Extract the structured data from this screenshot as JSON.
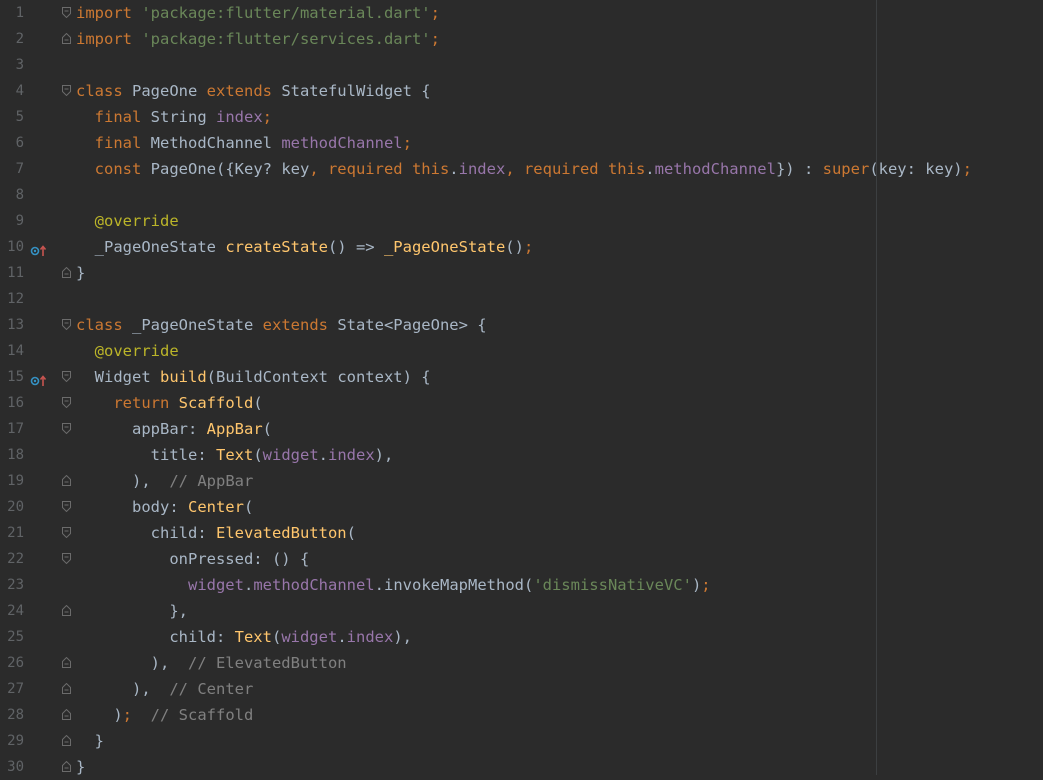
{
  "editor": {
    "language": "dart",
    "lines": [
      {
        "n": "1",
        "fold": "start",
        "mark": "",
        "tokens": [
          [
            "kw",
            "import "
          ],
          [
            "str",
            "'package:flutter/material.dart'"
          ],
          [
            "kw",
            ";"
          ]
        ]
      },
      {
        "n": "2",
        "fold": "end",
        "mark": "",
        "tokens": [
          [
            "kw",
            "import "
          ],
          [
            "str",
            "'package:flutter/services.dart'"
          ],
          [
            "kw",
            ";"
          ]
        ]
      },
      {
        "n": "3",
        "fold": "",
        "mark": "",
        "tokens": []
      },
      {
        "n": "4",
        "fold": "start",
        "mark": "",
        "tokens": [
          [
            "kw",
            "class "
          ],
          [
            "pl",
            "PageOne "
          ],
          [
            "kw",
            "extends "
          ],
          [
            "pl",
            "StatefulWidget {"
          ]
        ]
      },
      {
        "n": "5",
        "fold": "",
        "mark": "",
        "tokens": [
          [
            "pl",
            "  "
          ],
          [
            "kw",
            "final "
          ],
          [
            "pl",
            "String "
          ],
          [
            "fld",
            "index"
          ],
          [
            "kw",
            ";"
          ]
        ]
      },
      {
        "n": "6",
        "fold": "",
        "mark": "",
        "tokens": [
          [
            "pl",
            "  "
          ],
          [
            "kw",
            "final "
          ],
          [
            "pl",
            "MethodChannel "
          ],
          [
            "fld",
            "methodChannel"
          ],
          [
            "kw",
            ";"
          ]
        ]
      },
      {
        "n": "7",
        "fold": "",
        "mark": "",
        "tokens": [
          [
            "pl",
            "  "
          ],
          [
            "kw",
            "const "
          ],
          [
            "pl",
            "PageOne({Key? key"
          ],
          [
            "kw",
            ", required this"
          ],
          [
            "pl",
            "."
          ],
          [
            "fld",
            "index"
          ],
          [
            "kw",
            ", required this"
          ],
          [
            "pl",
            "."
          ],
          [
            "fld",
            "methodChannel"
          ],
          [
            "pl",
            "}) : "
          ],
          [
            "kw",
            "super"
          ],
          [
            "pl",
            "(key: key)"
          ],
          [
            "kw",
            ";"
          ]
        ]
      },
      {
        "n": "8",
        "fold": "",
        "mark": "",
        "tokens": []
      },
      {
        "n": "9",
        "fold": "",
        "mark": "",
        "tokens": [
          [
            "pl",
            "  "
          ],
          [
            "ann",
            "@override"
          ]
        ]
      },
      {
        "n": "10",
        "fold": "",
        "mark": "override",
        "tokens": [
          [
            "pl",
            "  _PageOneState "
          ],
          [
            "fn",
            "createState"
          ],
          [
            "pl",
            "() => "
          ],
          [
            "fn",
            "_PageOneState"
          ],
          [
            "pl",
            "()"
          ],
          [
            "kw",
            ";"
          ]
        ]
      },
      {
        "n": "11",
        "fold": "end",
        "mark": "",
        "tokens": [
          [
            "pl",
            "}"
          ]
        ]
      },
      {
        "n": "12",
        "fold": "",
        "mark": "",
        "tokens": []
      },
      {
        "n": "13",
        "fold": "start",
        "mark": "",
        "tokens": [
          [
            "kw",
            "class "
          ],
          [
            "pl",
            "_PageOneState "
          ],
          [
            "kw",
            "extends "
          ],
          [
            "pl",
            "State<PageOne> {"
          ]
        ]
      },
      {
        "n": "14",
        "fold": "",
        "mark": "",
        "tokens": [
          [
            "pl",
            "  "
          ],
          [
            "ann",
            "@override"
          ]
        ]
      },
      {
        "n": "15",
        "fold": "start",
        "mark": "override",
        "tokens": [
          [
            "pl",
            "  Widget "
          ],
          [
            "fn",
            "build"
          ],
          [
            "pl",
            "(BuildContext context) {"
          ]
        ]
      },
      {
        "n": "16",
        "fold": "start",
        "mark": "",
        "tokens": [
          [
            "pl",
            "    "
          ],
          [
            "kw",
            "return "
          ],
          [
            "fn",
            "Scaffold"
          ],
          [
            "pl",
            "("
          ]
        ]
      },
      {
        "n": "17",
        "fold": "start",
        "mark": "",
        "tokens": [
          [
            "pl",
            "      appBar: "
          ],
          [
            "fn",
            "AppBar"
          ],
          [
            "pl",
            "("
          ]
        ]
      },
      {
        "n": "18",
        "fold": "",
        "mark": "",
        "tokens": [
          [
            "pl",
            "        title: "
          ],
          [
            "fn",
            "Text"
          ],
          [
            "pl",
            "("
          ],
          [
            "fld",
            "widget"
          ],
          [
            "pl",
            "."
          ],
          [
            "fld",
            "index"
          ],
          [
            "pl",
            "),"
          ]
        ]
      },
      {
        "n": "19",
        "fold": "end",
        "mark": "",
        "tokens": [
          [
            "pl",
            "      ),  "
          ],
          [
            "cm",
            "// AppBar"
          ]
        ]
      },
      {
        "n": "20",
        "fold": "start",
        "mark": "",
        "tokens": [
          [
            "pl",
            "      body: "
          ],
          [
            "fn",
            "Center"
          ],
          [
            "pl",
            "("
          ]
        ]
      },
      {
        "n": "21",
        "fold": "start",
        "mark": "",
        "tokens": [
          [
            "pl",
            "        child: "
          ],
          [
            "fn",
            "ElevatedButton"
          ],
          [
            "pl",
            "("
          ]
        ]
      },
      {
        "n": "22",
        "fold": "start",
        "mark": "",
        "tokens": [
          [
            "pl",
            "          onPressed: () {"
          ]
        ]
      },
      {
        "n": "23",
        "fold": "",
        "mark": "",
        "tokens": [
          [
            "pl",
            "            "
          ],
          [
            "fld",
            "widget"
          ],
          [
            "pl",
            "."
          ],
          [
            "fld",
            "methodChannel"
          ],
          [
            "pl",
            "."
          ],
          [
            "pl",
            "invokeMapMethod("
          ],
          [
            "str",
            "'dismissNativeVC'"
          ],
          [
            "pl",
            ")"
          ],
          [
            "kw",
            ";"
          ]
        ]
      },
      {
        "n": "24",
        "fold": "end",
        "mark": "",
        "tokens": [
          [
            "pl",
            "          },"
          ]
        ]
      },
      {
        "n": "25",
        "fold": "",
        "mark": "",
        "tokens": [
          [
            "pl",
            "          child: "
          ],
          [
            "fn",
            "Text"
          ],
          [
            "pl",
            "("
          ],
          [
            "fld",
            "widget"
          ],
          [
            "pl",
            "."
          ],
          [
            "fld",
            "index"
          ],
          [
            "pl",
            "),"
          ]
        ]
      },
      {
        "n": "26",
        "fold": "end",
        "mark": "",
        "tokens": [
          [
            "pl",
            "        ),  "
          ],
          [
            "cm",
            "// ElevatedButton"
          ]
        ]
      },
      {
        "n": "27",
        "fold": "end",
        "mark": "",
        "tokens": [
          [
            "pl",
            "      ),  "
          ],
          [
            "cm",
            "// Center"
          ]
        ]
      },
      {
        "n": "28",
        "fold": "end",
        "mark": "",
        "tokens": [
          [
            "pl",
            "    )"
          ],
          [
            "kw",
            ";  "
          ],
          [
            "cm",
            "// Scaffold"
          ]
        ]
      },
      {
        "n": "29",
        "fold": "end",
        "mark": "",
        "tokens": [
          [
            "pl",
            "  }"
          ]
        ]
      },
      {
        "n": "30",
        "fold": "end",
        "mark": "",
        "tokens": [
          [
            "pl",
            "}"
          ]
        ]
      }
    ]
  },
  "colors": {
    "background": "#2b2b2b",
    "keyword": "#cc7832",
    "string": "#6a8759",
    "function": "#ffc66d",
    "field": "#9876aa",
    "annotation": "#bbb529",
    "comment": "#808080",
    "plain": "#a9b7c6",
    "line_number": "#606366"
  },
  "icons": {
    "fold_marker": "fold-marker-icon",
    "override_marker": "override-gutter-icon"
  }
}
